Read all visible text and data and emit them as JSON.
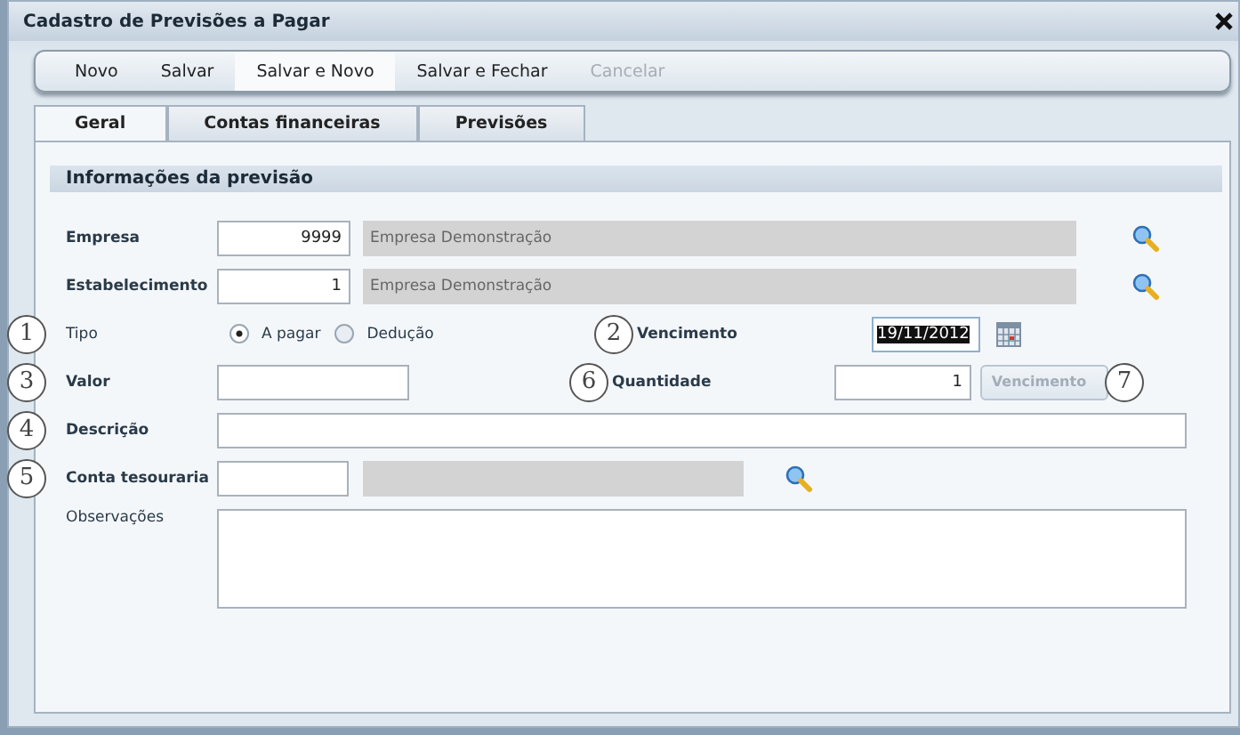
{
  "window": {
    "title": "Cadastro de Previsões a Pagar"
  },
  "toolbar": [
    {
      "label": "Novo",
      "selected": false,
      "disabled": false
    },
    {
      "label": "Salvar",
      "selected": false,
      "disabled": false
    },
    {
      "label": "Salvar e Novo",
      "selected": true,
      "disabled": false
    },
    {
      "label": "Salvar e Fechar",
      "selected": false,
      "disabled": false
    },
    {
      "label": "Cancelar",
      "selected": false,
      "disabled": true
    }
  ],
  "tabs": [
    {
      "label": "Geral",
      "selected": true
    },
    {
      "label": "Contas financeiras",
      "selected": false
    },
    {
      "label": "Previsões",
      "selected": false
    }
  ],
  "section": {
    "title": "Informações da previsão"
  },
  "rows": [
    {
      "kind": "lookup",
      "label": "Empresa",
      "bold": true,
      "code": "9999",
      "description": "Empresa Demonstração"
    },
    {
      "kind": "lookup",
      "label": "Estabelecimento",
      "bold": true,
      "code": "1",
      "description": "Empresa Demonstração"
    },
    {
      "kind": "radio",
      "marker": "1",
      "label": "Tipo",
      "bold": false,
      "options": [
        {
          "label": "A pagar",
          "selected": true
        },
        {
          "label": "Dedução",
          "selected": false
        }
      ],
      "right": {
        "marker": "2",
        "label": "Vencimento",
        "value": "19/11/2012",
        "value_selected": true
      }
    },
    {
      "kind": "amount",
      "marker": "3",
      "label": "Valor",
      "bold": true,
      "right": {
        "marker": "6",
        "label": "Quantidade",
        "value": "1",
        "button": {
          "label": "Vencimento",
          "disabled": true,
          "marker": "7"
        }
      }
    },
    {
      "kind": "text",
      "marker": "4",
      "label": "Descrição",
      "bold": true
    },
    {
      "kind": "short-lookup",
      "marker": "5",
      "label": "Conta tesouraria",
      "bold": true
    },
    {
      "kind": "memo",
      "label": "Observações",
      "bold": false
    }
  ]
}
